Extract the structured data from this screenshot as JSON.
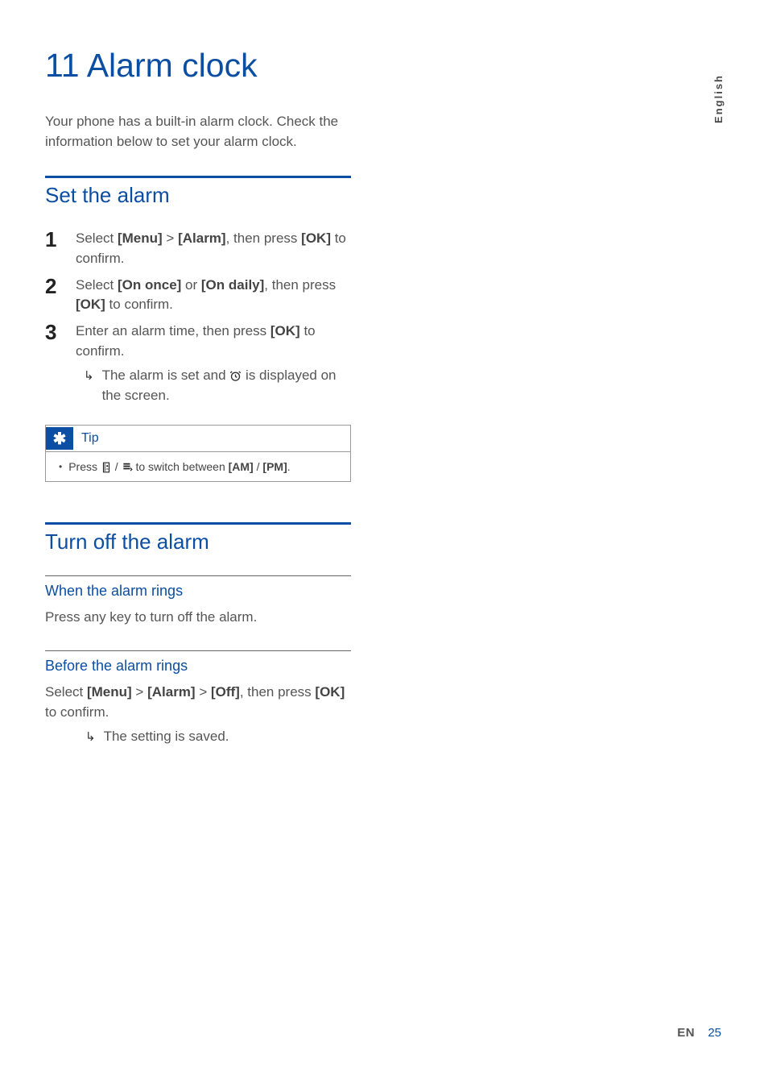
{
  "language_tab": "English",
  "chapter": {
    "number": "11",
    "title": "Alarm clock"
  },
  "intro": "Your phone has a built-in alarm clock. Check the information below to set your alarm clock.",
  "section_set": {
    "title": "Set the alarm",
    "steps": {
      "s1": {
        "num": "1",
        "pre": "Select ",
        "b1": "[Menu]",
        "mid1": " > ",
        "b2": "[Alarm]",
        "mid2": ", then press ",
        "b3": "[OK]",
        "post": " to confirm."
      },
      "s2": {
        "num": "2",
        "pre": "Select ",
        "b1": "[On once]",
        "mid1": " or ",
        "b2": "[On daily]",
        "mid2": ", then press ",
        "b3": "[OK]",
        "post": " to confirm."
      },
      "s3": {
        "num": "3",
        "pre": "Enter an alarm time, then press ",
        "b1": "[OK]",
        "post": " to confirm.",
        "result": {
          "pre": "The alarm is set and ",
          "post": " is displayed on the screen."
        }
      }
    }
  },
  "tip": {
    "label": "Tip",
    "text_pre": "Press ",
    "text_mid": " / ",
    "text_post": " to switch between ",
    "b1": "[AM]",
    "sep": " / ",
    "b2": "[PM]",
    "end": "."
  },
  "section_off": {
    "title": "Turn off the alarm",
    "sub1": {
      "title": "When the alarm rings",
      "body": "Press any key to turn off the alarm."
    },
    "sub2": {
      "title": "Before the alarm rings",
      "pre": "Select ",
      "b1": "[Menu]",
      "m1": " > ",
      "b2": "[Alarm]",
      "m2": " > ",
      "b3": "[Off]",
      "m3": ", then press ",
      "b4": "[OK]",
      "post": " to confirm.",
      "result": "The setting is saved."
    }
  },
  "footer": {
    "lang": "EN",
    "page": "25"
  }
}
